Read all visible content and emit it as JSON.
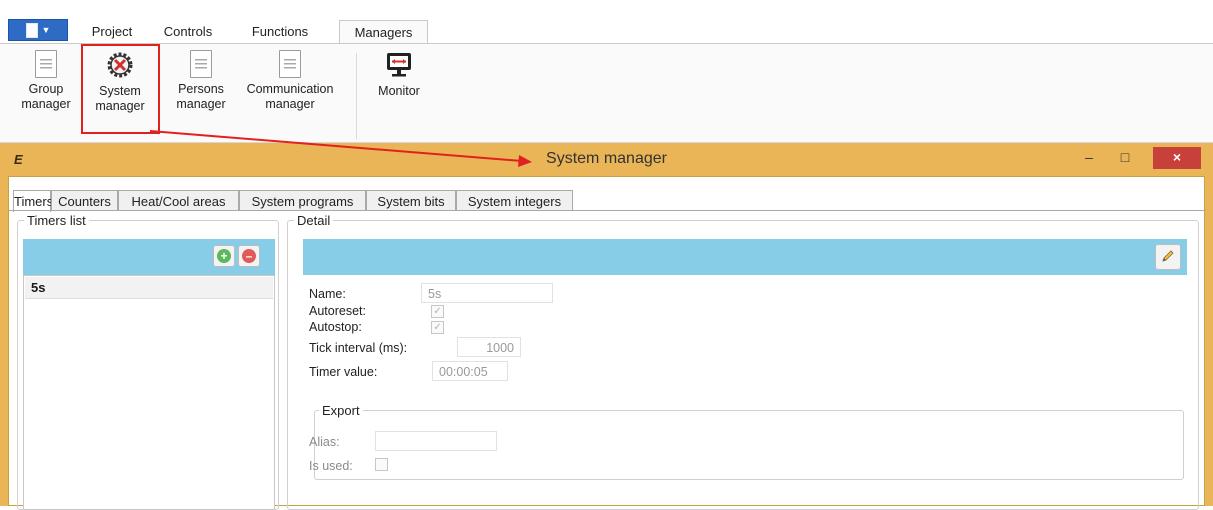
{
  "ribbon": {
    "tabs": [
      "Project",
      "Controls",
      "Functions",
      "Managers"
    ],
    "active_tab": "Managers",
    "buttons": [
      {
        "line1": "Group",
        "line2": "manager",
        "icon": "document-icon"
      },
      {
        "line1": "System",
        "line2": "manager",
        "icon": "system-tools-icon"
      },
      {
        "line1": "Persons",
        "line2": "manager",
        "icon": "document-icon"
      },
      {
        "line1": "Communication",
        "line2": "manager",
        "icon": "document-icon"
      },
      {
        "line1": "Monitor",
        "line2": "",
        "icon": "monitor-icon"
      }
    ]
  },
  "window": {
    "title": "System manager",
    "logo": "E",
    "minimize": "–",
    "maximize": "□",
    "close": "×",
    "tabs": [
      "Timers",
      "Counters",
      "Heat/Cool areas",
      "System programs",
      "System bits",
      "System integers"
    ],
    "active_tab": "Timers"
  },
  "timers_list": {
    "title": "Timers list",
    "items": [
      "5s"
    ]
  },
  "detail": {
    "title": "Detail",
    "name_label": "Name:",
    "name_value": "5s",
    "autoreset_label": "Autoreset:",
    "autoreset_checked": true,
    "autostop_label": "Autostop:",
    "autostop_checked": true,
    "tick_label": "Tick interval (ms):",
    "tick_value": "1000",
    "timer_value_label": "Timer value:",
    "timer_value": "00:00:05",
    "export": {
      "title": "Export",
      "alias_label": "Alias:",
      "alias_value": "",
      "is_used_label": "Is used:",
      "is_used_checked": false
    }
  },
  "colors": {
    "title_bar": "#e9b556",
    "blue_bar": "#87cde7",
    "highlight": "#e0211f",
    "close_button": "#c7403a",
    "add_button": "#5cb85c",
    "remove_button": "#e05a5a"
  }
}
